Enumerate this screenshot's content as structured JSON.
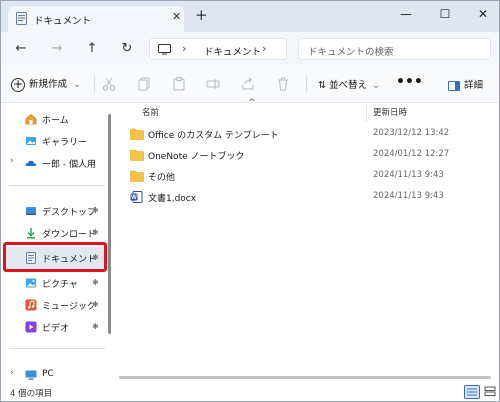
{
  "colors": {
    "folder": "#f4c542",
    "accent": "#2f6cc4",
    "highlight": "#e0141c",
    "selected_bg": "#e2e8f0"
  },
  "titlebar": {
    "tab_title": "ドキュメント",
    "tab_close_glyph": "✕",
    "new_tab_glyph": "+",
    "minimize_glyph": "—",
    "maximize_glyph": "☐",
    "close_glyph": "✕"
  },
  "addressbar": {
    "back_glyph": "←",
    "forward_glyph": "→",
    "up_glyph": "↑",
    "refresh_glyph": "↻",
    "breadcrumb_sep": "›",
    "breadcrumb": "ドキュメント",
    "search_placeholder": "ドキュメントの検索"
  },
  "commandbar": {
    "new_label": "新規作成",
    "sort_label": "並べ替え",
    "more_label": "•••",
    "details_label": "詳細",
    "icons": [
      "cut-icon",
      "copy-icon",
      "paste-icon",
      "rename-icon",
      "share-icon",
      "delete-icon"
    ]
  },
  "sidebar": {
    "items": [
      {
        "label": "ホーム",
        "icon": "home-icon"
      },
      {
        "label": "ギャラリー",
        "icon": "gallery-icon"
      },
      {
        "label": "一郎 - 個人用",
        "icon": "onedrive-icon"
      },
      {
        "label": "デスクトップ",
        "icon": "desktop-icon",
        "pinned": true
      },
      {
        "label": "ダウンロード",
        "icon": "download-icon",
        "pinned": true
      },
      {
        "label": "ドキュメント",
        "icon": "documents-icon",
        "pinned": true,
        "selected": true
      },
      {
        "label": "ピクチャ",
        "icon": "pictures-icon",
        "pinned": true
      },
      {
        "label": "ミュージック",
        "icon": "music-icon",
        "pinned": true
      },
      {
        "label": "ビデオ",
        "icon": "videos-icon",
        "pinned": true
      },
      {
        "label": "PC",
        "icon": "pc-icon"
      }
    ],
    "chevron_glyph": "›",
    "pin_glyph": "✱"
  },
  "main": {
    "columns": {
      "name": "名前",
      "modified": "更新日時"
    },
    "sort_caret": "^",
    "files": [
      {
        "name": "Office のカスタム テンプレート",
        "date": "2023/12/12 13:42",
        "type": "folder"
      },
      {
        "name": "OneNote ノートブック",
        "date": "2024/01/12 12:27",
        "type": "folder"
      },
      {
        "name": "その他",
        "date": "2024/11/13 9:43",
        "type": "folder"
      },
      {
        "name": "文書1.docx",
        "date": "2024/11/13 9:43",
        "type": "docx"
      }
    ]
  },
  "statusbar": {
    "item_count": "4 個の項目"
  }
}
